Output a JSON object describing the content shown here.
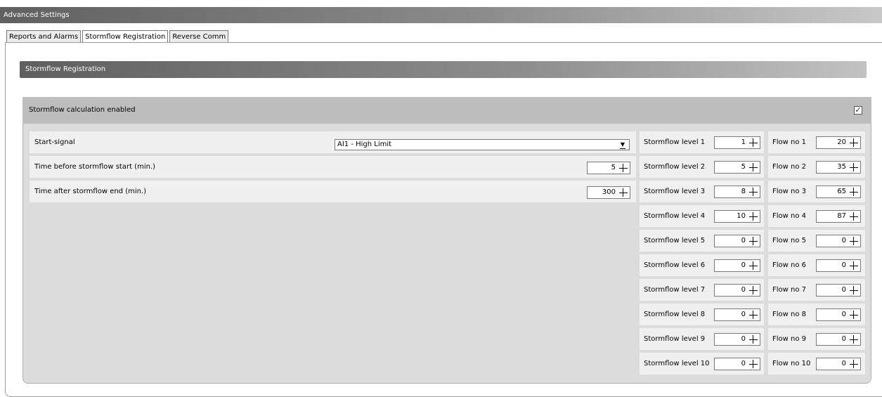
{
  "window": {
    "title": "Advanced Settings"
  },
  "tabs": [
    {
      "label": "Reports and Alarms",
      "active": false
    },
    {
      "label": "Stormflow Registration",
      "active": true
    },
    {
      "label": "Reverse Comm",
      "active": false
    }
  ],
  "section": {
    "title": "Stormflow Registration"
  },
  "group": {
    "title": "Stormflow calculation enabled",
    "enabled": true,
    "check_glyph": "✓"
  },
  "settings": {
    "start_signal": {
      "label": "Start-signal",
      "value": "AI1 - High Limit"
    },
    "time_before": {
      "label": "Time before stormflow start (min.)",
      "value": "5"
    },
    "time_after": {
      "label": "Time after stormflow end (min.)",
      "value": "300"
    }
  },
  "levels": [
    {
      "label": "Stormflow level 1",
      "value": "1",
      "flow_label": "Flow no 1",
      "flow_value": "20"
    },
    {
      "label": "Stormflow level 2",
      "value": "5",
      "flow_label": "Flow no 2",
      "flow_value": "35"
    },
    {
      "label": "Stormflow level 3",
      "value": "8",
      "flow_label": "Flow no 3",
      "flow_value": "65"
    },
    {
      "label": "Stormflow level 4",
      "value": "10",
      "flow_label": "Flow no 4",
      "flow_value": "87"
    },
    {
      "label": "Stormflow level 5",
      "value": "0",
      "flow_label": "Flow no 5",
      "flow_value": "0"
    },
    {
      "label": "Stormflow level 6",
      "value": "0",
      "flow_label": "Flow no 6",
      "flow_value": "0"
    },
    {
      "label": "Stormflow level 7",
      "value": "0",
      "flow_label": "Flow no 7",
      "flow_value": "0"
    },
    {
      "label": "Stormflow level 8",
      "value": "0",
      "flow_label": "Flow no 8",
      "flow_value": "0"
    },
    {
      "label": "Stormflow level 9",
      "value": "0",
      "flow_label": "Flow no 9",
      "flow_value": "0"
    },
    {
      "label": "Stormflow level 10",
      "value": "0",
      "flow_label": "Flow no 10",
      "flow_value": "0"
    }
  ]
}
